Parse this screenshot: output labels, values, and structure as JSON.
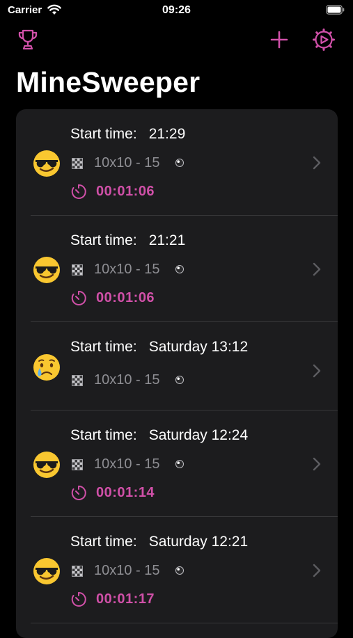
{
  "status_bar": {
    "carrier": "Carrier",
    "time": "09:26"
  },
  "nav": {
    "left_icon": "trophy-icon",
    "right_icons": [
      "plus-icon",
      "gear-icon"
    ]
  },
  "title": "MineSweeper",
  "colors": {
    "accent": "#d050a8",
    "background": "#000000",
    "card": "#1c1c1e",
    "secondary_text": "#8e8e93"
  },
  "games": [
    {
      "emoji": "smiling-face-with-sunglasses",
      "start_label": "Start time:",
      "start_time": "21:29",
      "board": "10x10 - 15",
      "elapsed": "00:01:06"
    },
    {
      "emoji": "smiling-face-with-sunglasses",
      "start_label": "Start time:",
      "start_time": "21:21",
      "board": "10x10 - 15",
      "elapsed": "00:01:06"
    },
    {
      "emoji": "crying-face",
      "start_label": "Start time:",
      "start_time": "Saturday 13:12",
      "board": "10x10 - 15",
      "elapsed": ""
    },
    {
      "emoji": "smiling-face-with-sunglasses",
      "start_label": "Start time:",
      "start_time": "Saturday 12:24",
      "board": "10x10 - 15",
      "elapsed": "00:01:14"
    },
    {
      "emoji": "smiling-face-with-sunglasses",
      "start_label": "Start time:",
      "start_time": "Saturday 12:21",
      "board": "10x10 - 15",
      "elapsed": "00:01:17"
    }
  ]
}
